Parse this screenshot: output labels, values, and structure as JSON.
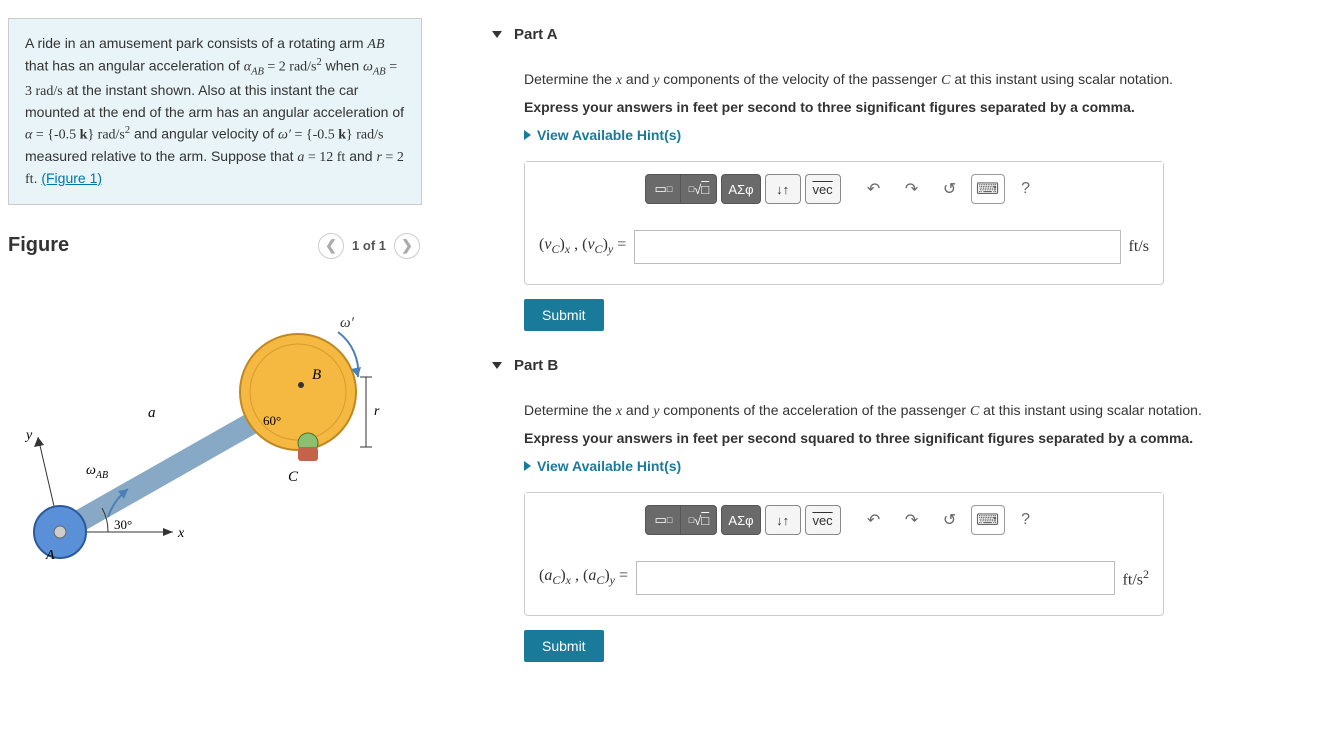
{
  "problem_text": {
    "line1_pre": "A ride in an amusement park consists of a rotating arm ",
    "var_AB": "AB",
    "line1_mid": " that has an angular acceleration of ",
    "alpha_ab": "α",
    "alpha_ab_sub": "AB",
    "eq1": " = 2 rad/s",
    "line2_pre": " when ",
    "omega_ab": "ω",
    "omega_ab_sub": "AB",
    "eq2": " = 3 rad/s",
    "line2_post": " at the instant shown. Also at this instant the car mounted at the end of the arm has an angular acceleration of ",
    "alpha_var": "α",
    "eq3": " = {-0.5 ",
    "k_hat": "k",
    "eq3b": "} rad/s",
    "line3_mid": " and angular velocity of ",
    "omega_prime": "ω′",
    "eq4": " = {-0.5 ",
    "eq4b": "} rad/s",
    "line3_post": " measured relative to the arm. Suppose that ",
    "a_var": "a",
    "eq5": " = 12 ft",
    "and_text": " and ",
    "r_var": "r",
    "eq6": " = 2 ft",
    "period": ". ",
    "figure_link": "(Figure 1)"
  },
  "figure": {
    "heading": "Figure",
    "nav_label": "1 of 1",
    "labels": {
      "omega_prime": "ω′",
      "B": "B",
      "r": "r",
      "sixty": "60°",
      "C": "C",
      "a": "a",
      "y": "y",
      "omega_ab": "ω",
      "omega_ab_sub": "AB",
      "thirty": "30°",
      "x": "x",
      "A": "A"
    }
  },
  "partA": {
    "title": "Part A",
    "question_pre": "Determine the ",
    "x_var": "x",
    "and_text": " and ",
    "y_var": "y",
    "question_post": " components of the velocity of the passenger ",
    "C_var": "C",
    "question_end": " at this instant using scalar notation.",
    "instruct": "Express your answers in feet per second to three significant figures separated by a comma.",
    "hints": "View Available Hint(s)",
    "label_html": "(v_C)_x , (v_C)_y =",
    "unit": "ft/s",
    "submit": "Submit"
  },
  "partB": {
    "title": "Part B",
    "question_pre": "Determine the ",
    "x_var": "x",
    "and_text": " and ",
    "y_var": "y",
    "question_post": " components of the acceleration of the passenger ",
    "C_var": "C",
    "question_end": " at this instant using scalar notation.",
    "instruct": "Express your answers in feet per second squared to three significant figures separated by a comma.",
    "hints": "View Available Hint(s)",
    "unit": "ft/s²",
    "submit": "Submit"
  },
  "toolbar": {
    "template": "▭",
    "frac": "√",
    "greek": "ΑΣφ",
    "updown": "↓↑",
    "vec": "vec",
    "undo": "↶",
    "redo": "↷",
    "reset": "↺",
    "keyboard": "⌨",
    "help": "?"
  }
}
